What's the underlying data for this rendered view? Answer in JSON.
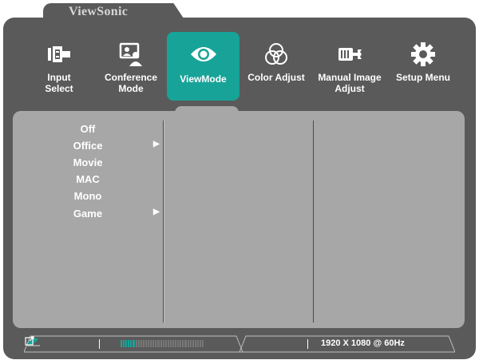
{
  "brand": "ViewSonic",
  "menu": [
    {
      "label": "Input\nSelect",
      "icon": "input-select-icon"
    },
    {
      "label": "Conference\nMode",
      "icon": "conference-mode-icon"
    },
    {
      "label": "ViewMode",
      "icon": "eye-icon",
      "active": true
    },
    {
      "label": "Color Adjust",
      "icon": "color-circles-icon"
    },
    {
      "label": "Manual Image\nAdjust",
      "icon": "hand-wrench-icon"
    },
    {
      "label": "Setup Menu",
      "icon": "gear-icon"
    }
  ],
  "viewmode_options": [
    {
      "label": "Off",
      "has_submenu": false
    },
    {
      "label": "Office",
      "has_submenu": true
    },
    {
      "label": "Movie",
      "has_submenu": false
    },
    {
      "label": "MAC",
      "has_submenu": false
    },
    {
      "label": "Mono",
      "has_submenu": false
    },
    {
      "label": "Game",
      "has_submenu": true
    }
  ],
  "status_bar": {
    "resolution": "1920 X 1080 @ 60Hz",
    "signal_level": 0.18
  },
  "colors": {
    "accent": "#17a398",
    "frame": "#5a5a5a",
    "panel": "#a7a7a7"
  }
}
